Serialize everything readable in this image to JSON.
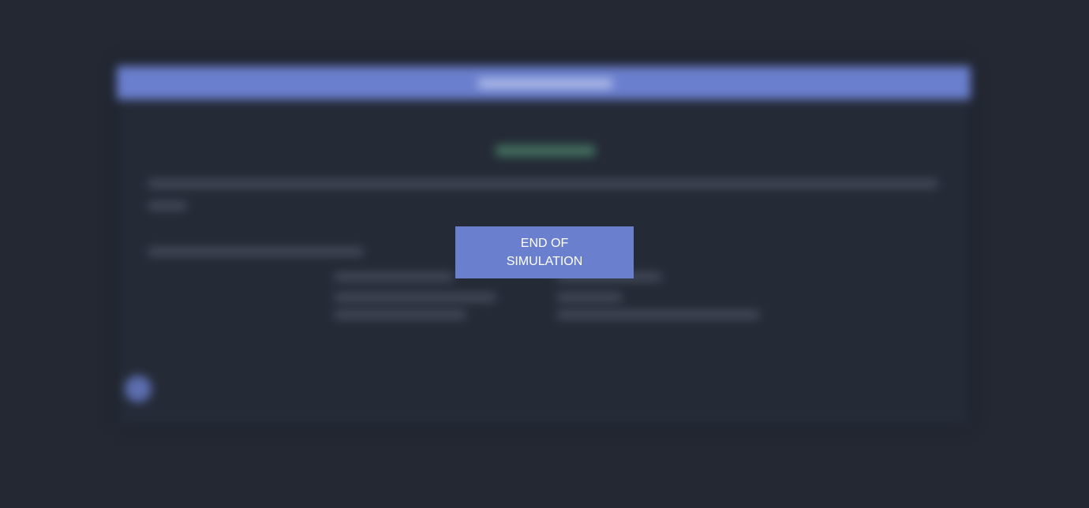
{
  "overlay": {
    "end_label": "END OF SIMULATION"
  },
  "colors": {
    "background": "#232833",
    "accent": "#6a7fce",
    "overlay_text": "#ffffff",
    "success": "#4f8a6e"
  }
}
